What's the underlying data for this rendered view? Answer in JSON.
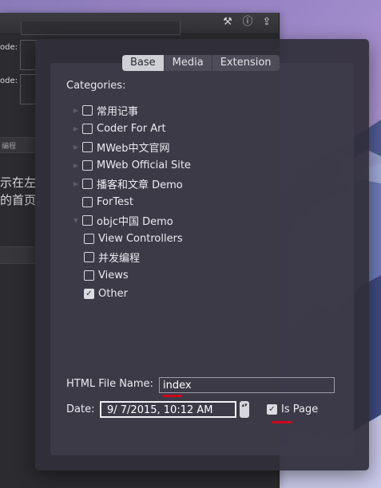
{
  "toolbar": {
    "icons": [
      "wrench-icon",
      "info-icon",
      "share-icon"
    ],
    "wrench_glyph": "⚒",
    "info_glyph": "ⓘ",
    "share_glyph": "⇪"
  },
  "background_editor": {
    "label_1": "ode:",
    "label_2": "ode:",
    "small_tag": "编程",
    "cjk_line_1": "示在左",
    "cjk_line_2": "的首页。"
  },
  "tabs": {
    "base": "Base",
    "media": "Media",
    "extension": "Extension",
    "active": "Base"
  },
  "categories_label": "Categories:",
  "categories": [
    {
      "label": "常用记事",
      "checked": false,
      "level": 0,
      "disclosure": "▶"
    },
    {
      "label": "Coder For Art",
      "checked": false,
      "level": 0,
      "disclosure": "▶"
    },
    {
      "label": "MWeb中文官网",
      "checked": false,
      "level": 0,
      "disclosure": "▶"
    },
    {
      "label": "MWeb Official Site",
      "checked": false,
      "level": 0,
      "disclosure": "▶"
    },
    {
      "label": "播客和文章 Demo",
      "checked": false,
      "level": 0,
      "disclosure": "▶"
    },
    {
      "label": "ForTest",
      "checked": false,
      "level": 0,
      "disclosure": ""
    },
    {
      "label": "objc中国 Demo",
      "checked": false,
      "level": 0,
      "disclosure": "▼"
    },
    {
      "label": "View Controllers",
      "checked": false,
      "level": 1,
      "disclosure": ""
    },
    {
      "label": "并发编程",
      "checked": false,
      "level": 1,
      "disclosure": ""
    },
    {
      "label": "Views",
      "checked": false,
      "level": 1,
      "disclosure": ""
    },
    {
      "label": "Other",
      "checked": true,
      "level": 1,
      "disclosure": ""
    }
  ],
  "html_file_name": {
    "label": "HTML File Name:",
    "value": "index"
  },
  "date": {
    "label": "Date:",
    "value": "9/  7/2015, 10:12 AM",
    "stepper_glyph": "▴▾"
  },
  "is_page": {
    "label": "Is Page",
    "checked": true,
    "check_glyph": "✓"
  },
  "colors": {
    "annotation_red": "#d0021b",
    "panel": "#302e3a",
    "wallpaper": "#9a86c6"
  }
}
